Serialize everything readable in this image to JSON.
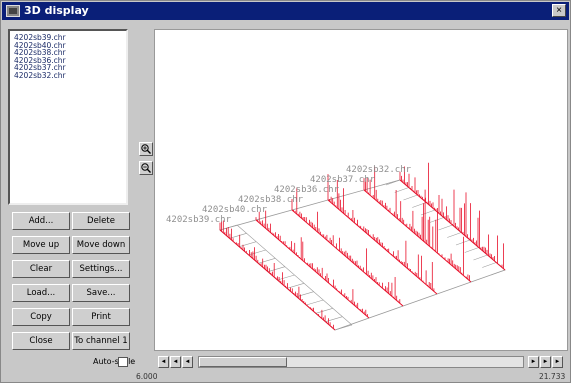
{
  "window": {
    "title": "3D display",
    "close_glyph": "×"
  },
  "files": [
    "4202sb39.chr",
    "4202sb40.chr",
    "4202sb38.chr",
    "4202sb36.chr",
    "4202sb37.chr",
    "4202sb32.chr"
  ],
  "buttons": {
    "add": "Add...",
    "delete": "Delete",
    "move_up": "Move up",
    "move_down": "Move down",
    "clear": "Clear",
    "settings": "Settings...",
    "load": "Load...",
    "save": "Save...",
    "copy": "Copy",
    "print": "Print",
    "close": "Close",
    "to_channel": "To channel 1"
  },
  "autoscale": {
    "label": "Auto-scale",
    "checked": false
  },
  "zoom_icons": [
    "zoom-in-icon",
    "zoom-out-icon"
  ],
  "plot": {
    "trace_color": "#e8102a",
    "grid_color": "#9a9a9a",
    "labels": [
      "4202sb39.chr",
      "4202sb40.chr",
      "4202sb38.chr",
      "4202sb36.chr",
      "4202sb37.chr",
      "4202sb32.chr"
    ]
  },
  "scrollbar": {
    "arrow_left": "◄",
    "arrow_right": "►"
  },
  "range": {
    "min": "6.000",
    "max": "21.733"
  }
}
